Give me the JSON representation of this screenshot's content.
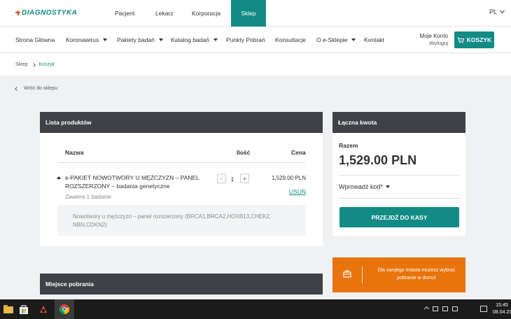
{
  "header": {
    "logo": "DIAGNOSTYKA",
    "nav": [
      {
        "label": "Pacjent"
      },
      {
        "label": "Lekarz"
      },
      {
        "label": "Korporacja"
      },
      {
        "label": "Sklep",
        "active": true
      }
    ],
    "lang": "PL"
  },
  "subnav": {
    "items": [
      "Strona Główna",
      "Koronawirus",
      "Pakiety badań",
      "Katalog badań",
      "Punkty Pobrań",
      "Konsultacje",
      "O e-Sklepie",
      "Kontakt"
    ],
    "account_label": "Moje Konto",
    "logout_label": "Wyloguj",
    "cart_label": "KOSZYK"
  },
  "breadcrumb": [
    "Sklep",
    "Koszyk"
  ],
  "back_label": "Wróć do sklepu",
  "products": {
    "title": "Lista produktów",
    "col_name": "Nazwa",
    "col_qty": "Ilość",
    "col_price": "Cena",
    "item": {
      "name": "e-PAKIET NOWOTWORY U MĘŻCZYZN – PANEL ROZSZERZONY – badania genetyczne",
      "contains": "Zawiera 1 badanie",
      "qty": "1",
      "minus": "-",
      "plus": "+",
      "price": "1,529.00 PLN",
      "remove": "USUŃ",
      "detail": "Nowotwory u mężczyzn – panel rozszerzony (BRCA1,BRCA2,HOXB13,CHEK2, NBN,CDKN2)"
    }
  },
  "total": {
    "title": "Łączna kwota",
    "label": "Razem",
    "amount": "1,529.00 PLN",
    "code_label": "Wprowadź kod*",
    "checkout": "PRZEJDŹ DO KASY"
  },
  "promo": {
    "text": "Dla swojego miasta możesz wybrać pobranie w domu!"
  },
  "pickup": {
    "title": "Miejsce pobrania"
  },
  "taskbar": {
    "time": "15:45",
    "date": "08.04.20"
  },
  "colors": {
    "accent": "#138b85",
    "dark_header": "#3f4147",
    "promo": "#e9730c"
  }
}
